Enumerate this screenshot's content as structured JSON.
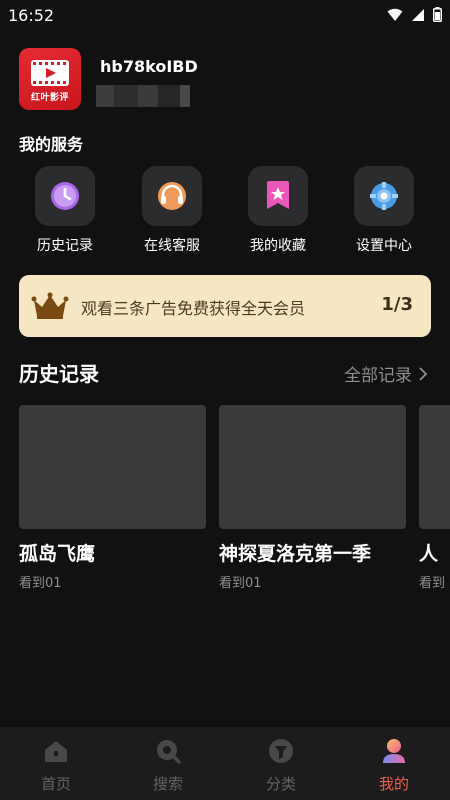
{
  "status_bar": {
    "time": "16:52"
  },
  "profile": {
    "logo_text": "红叶影评",
    "username": "hb78koIBD"
  },
  "services": {
    "title": "我的服务",
    "items": [
      {
        "label": "历史记录",
        "icon": "clock-icon",
        "color": "#a866e8"
      },
      {
        "label": "在线客服",
        "icon": "headset-icon",
        "color": "#f09a5a"
      },
      {
        "label": "我的收藏",
        "icon": "bookmark-star-icon",
        "color": "#e958b8"
      },
      {
        "label": "设置中心",
        "icon": "gear-icon",
        "color": "#4a9ce8"
      }
    ]
  },
  "banner": {
    "text": "观看三条广告免费获得全天会员",
    "count": "1/3",
    "icon": "crown-icon"
  },
  "history": {
    "title": "历史记录",
    "all_label": "全部记录",
    "cards": [
      {
        "title": "孤岛飞鹰",
        "progress": "看到01"
      },
      {
        "title": "神探夏洛克第一季",
        "progress": "看到01"
      },
      {
        "title": "人",
        "progress": "看到"
      }
    ]
  },
  "bottom_nav": {
    "items": [
      {
        "label": "首页",
        "icon": "home-icon",
        "active": false
      },
      {
        "label": "搜索",
        "icon": "search-icon",
        "active": false
      },
      {
        "label": "分类",
        "icon": "category-icon",
        "active": false
      },
      {
        "label": "我的",
        "icon": "profile-icon",
        "active": true
      }
    ],
    "active_color": "#f0614a"
  }
}
